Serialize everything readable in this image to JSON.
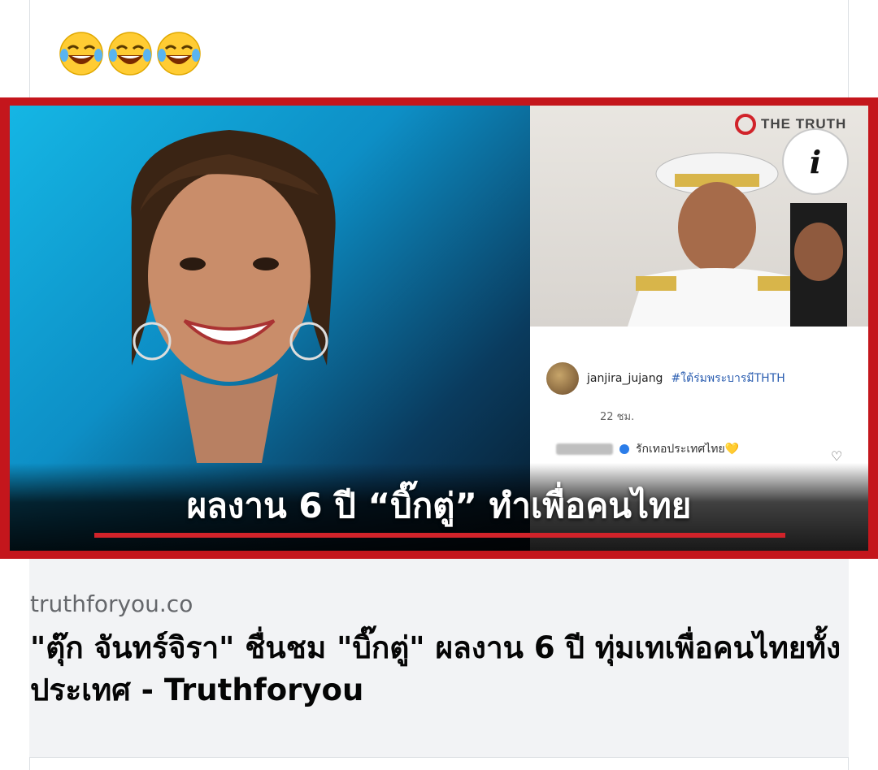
{
  "post": {
    "emojis": [
      "face-with-tears-of-joy-icon",
      "face-with-tears-of-joy-icon",
      "face-with-tears-of-joy-icon"
    ]
  },
  "image": {
    "headline": "ผลงาน 6 ปี “บิ๊กตู่” ทำเพื่อคนไทย",
    "brand": "THE TRUTH",
    "ig_username": "janjira_jujang",
    "ig_hashtag": "#ใต้ร่มพระบารมีTHTH",
    "ig_time": "22 ชม.",
    "ig_comment": "รักเทอประเทศไทย💛"
  },
  "link": {
    "domain": "truthforyou.co",
    "title": "\"ตุ๊ก จันทร์จิรา\" ชื่นชม \"บิ๊กตู่\" ผลงาน 6 ปี ทุ่มเทเพื่อคนไทยทั้งประเทศ - Truthforyou"
  },
  "colors": {
    "accent_red": "#c4161c",
    "meta_bg": "#f2f3f5",
    "domain_text": "#65676b"
  }
}
